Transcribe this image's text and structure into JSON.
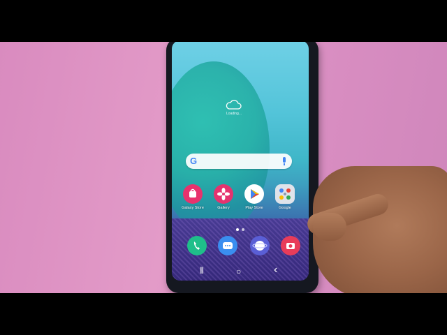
{
  "status": {
    "weather_icon": "cloud-icon",
    "loading_text": "Loading..."
  },
  "search": {
    "google_logo": "G",
    "mic_icon": "mic-icon"
  },
  "apps": [
    {
      "label": "Galaxy Store",
      "icon": "galaxy-store-icon",
      "color": "#e8326d"
    },
    {
      "label": "Gallery",
      "icon": "gallery-icon",
      "color": "#e5336f"
    },
    {
      "label": "Play Store",
      "icon": "play-store-icon",
      "color": "#ffffff"
    },
    {
      "label": "Google",
      "icon": "google-folder-icon",
      "color": "#dfe3ea"
    }
  ],
  "dock": [
    {
      "icon": "phone-icon",
      "color": "#1fbf8a"
    },
    {
      "icon": "messages-icon",
      "color": "#3a8ef0"
    },
    {
      "icon": "internet-icon",
      "color": "#5a5fd6"
    },
    {
      "icon": "camera-icon",
      "color": "#e83c5a"
    }
  ],
  "navigation": {
    "recents": "|||",
    "home": "○",
    "back": "‹"
  }
}
